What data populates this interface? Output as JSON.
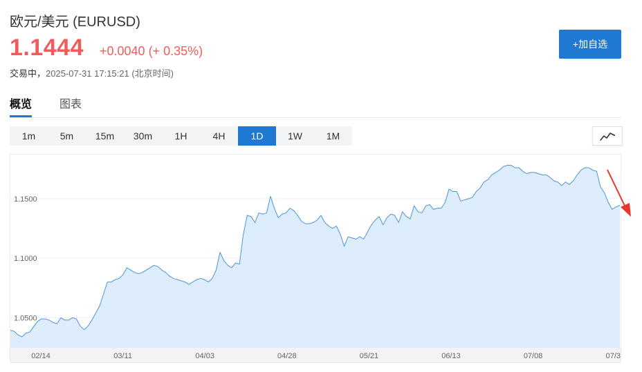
{
  "header": {
    "title": "欧元/美元  (EURUSD)",
    "price": "1.1444",
    "change": "+0.0040 (+ 0.35%)",
    "trade_label": "交易中，",
    "trade_time": "2025-07-31 17:15:21 (北京时间)"
  },
  "actions": {
    "add_watchlist": "+加自选"
  },
  "tabs": [
    {
      "label": "概览",
      "active": true
    },
    {
      "label": "图表",
      "active": false
    }
  ],
  "periods": [
    {
      "label": "1m"
    },
    {
      "label": "5m"
    },
    {
      "label": "15m"
    },
    {
      "label": "30m"
    },
    {
      "label": "1H"
    },
    {
      "label": "4H"
    },
    {
      "label": "1D",
      "active": true
    },
    {
      "label": "1W"
    },
    {
      "label": "1M"
    }
  ],
  "colors": {
    "accent": "#1f78d1",
    "up": "#f25b5b",
    "line": "#4a95d8",
    "area": "#deedfb",
    "annotation_arrow": "#e6372c"
  },
  "icons": {
    "trend": "trend-line-icon"
  },
  "chart_data": {
    "type": "area",
    "title": "",
    "xlabel": "",
    "ylabel": "",
    "ylim": [
      1.0247,
      1.1876
    ],
    "yticks": [
      "1.0500",
      "1.1000",
      "1.1500"
    ],
    "xticks": [
      "02/14",
      "03/11",
      "04/03",
      "04/28",
      "05/21",
      "06/13",
      "07/08",
      "07/3"
    ],
    "series": [
      {
        "values": [
          1.0395,
          1.0385,
          1.0355,
          1.034,
          1.037,
          1.038,
          1.0425,
          1.047,
          1.049,
          1.049,
          1.048,
          1.046,
          1.045,
          1.05,
          1.048,
          1.048,
          1.05,
          1.049,
          1.043,
          1.04,
          1.043,
          1.048,
          1.054,
          1.06,
          1.07,
          1.08,
          1.08,
          1.082,
          1.083,
          1.086,
          1.092,
          1.09,
          1.088,
          1.087,
          1.088,
          1.09,
          1.092,
          1.094,
          1.093,
          1.09,
          1.088,
          1.085,
          1.083,
          1.082,
          1.081,
          1.08,
          1.078,
          1.08,
          1.082,
          1.083,
          1.082,
          1.08,
          1.083,
          1.09,
          1.105,
          1.098,
          1.094,
          1.092,
          1.096,
          1.095,
          1.12,
          1.136,
          1.135,
          1.13,
          1.138,
          1.137,
          1.138,
          1.152,
          1.142,
          1.134,
          1.137,
          1.138,
          1.142,
          1.14,
          1.136,
          1.131,
          1.129,
          1.129,
          1.13,
          1.132,
          1.136,
          1.13,
          1.127,
          1.125,
          1.127,
          1.12,
          1.11,
          1.118,
          1.117,
          1.116,
          1.118,
          1.116,
          1.122,
          1.128,
          1.132,
          1.135,
          1.128,
          1.134,
          1.137,
          1.136,
          1.13,
          1.139,
          1.135,
          1.133,
          1.144,
          1.139,
          1.138,
          1.144,
          1.145,
          1.141,
          1.142,
          1.142,
          1.147,
          1.158,
          1.156,
          1.156,
          1.148,
          1.149,
          1.15,
          1.151,
          1.156,
          1.159,
          1.164,
          1.166,
          1.17,
          1.172,
          1.174,
          1.177,
          1.178,
          1.178,
          1.176,
          1.176,
          1.173,
          1.171,
          1.172,
          1.172,
          1.171,
          1.17,
          1.17,
          1.168,
          1.165,
          1.164,
          1.161,
          1.164,
          1.162,
          1.165,
          1.17,
          1.174,
          1.176,
          1.176,
          1.174,
          1.173,
          1.16,
          1.155,
          1.147,
          1.141,
          1.143,
          1.1444
        ]
      }
    ]
  }
}
